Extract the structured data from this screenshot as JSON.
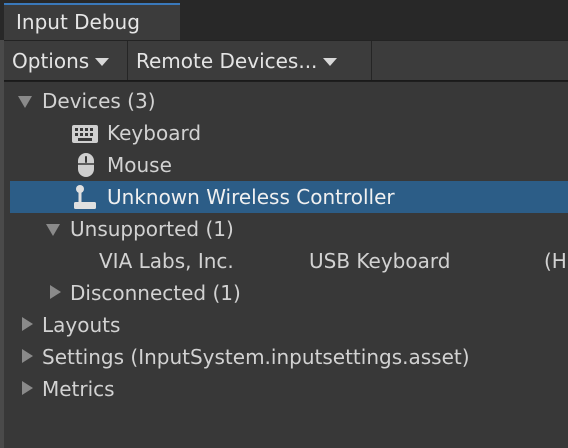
{
  "window": {
    "tab_title": "Input Debug"
  },
  "toolbar": {
    "options_label": "Options",
    "remote_devices_label": "Remote Devices..."
  },
  "tree": {
    "devices": {
      "label": "Devices (3)",
      "children": [
        {
          "label": "Keyboard",
          "icon": "keyboard-icon"
        },
        {
          "label": "Mouse",
          "icon": "mouse-icon"
        },
        {
          "label": "Unknown Wireless Controller",
          "icon": "joystick-icon",
          "selected": true
        }
      ],
      "unsupported": {
        "label": "Unsupported (1)",
        "items": [
          {
            "manufacturer": "VIA Labs, Inc.",
            "product": "USB Keyboard",
            "extra": "(H"
          }
        ]
      },
      "disconnected": {
        "label": "Disconnected (1)"
      }
    },
    "layouts": {
      "label": "Layouts"
    },
    "settings": {
      "label": "Settings (InputSystem.inputsettings.asset)"
    },
    "metrics": {
      "label": "Metrics"
    }
  },
  "colors": {
    "selection": "#2c5d87",
    "tab_accent": "#3a79bb",
    "panel": "#383838",
    "toolbar": "#3c3c3c"
  }
}
